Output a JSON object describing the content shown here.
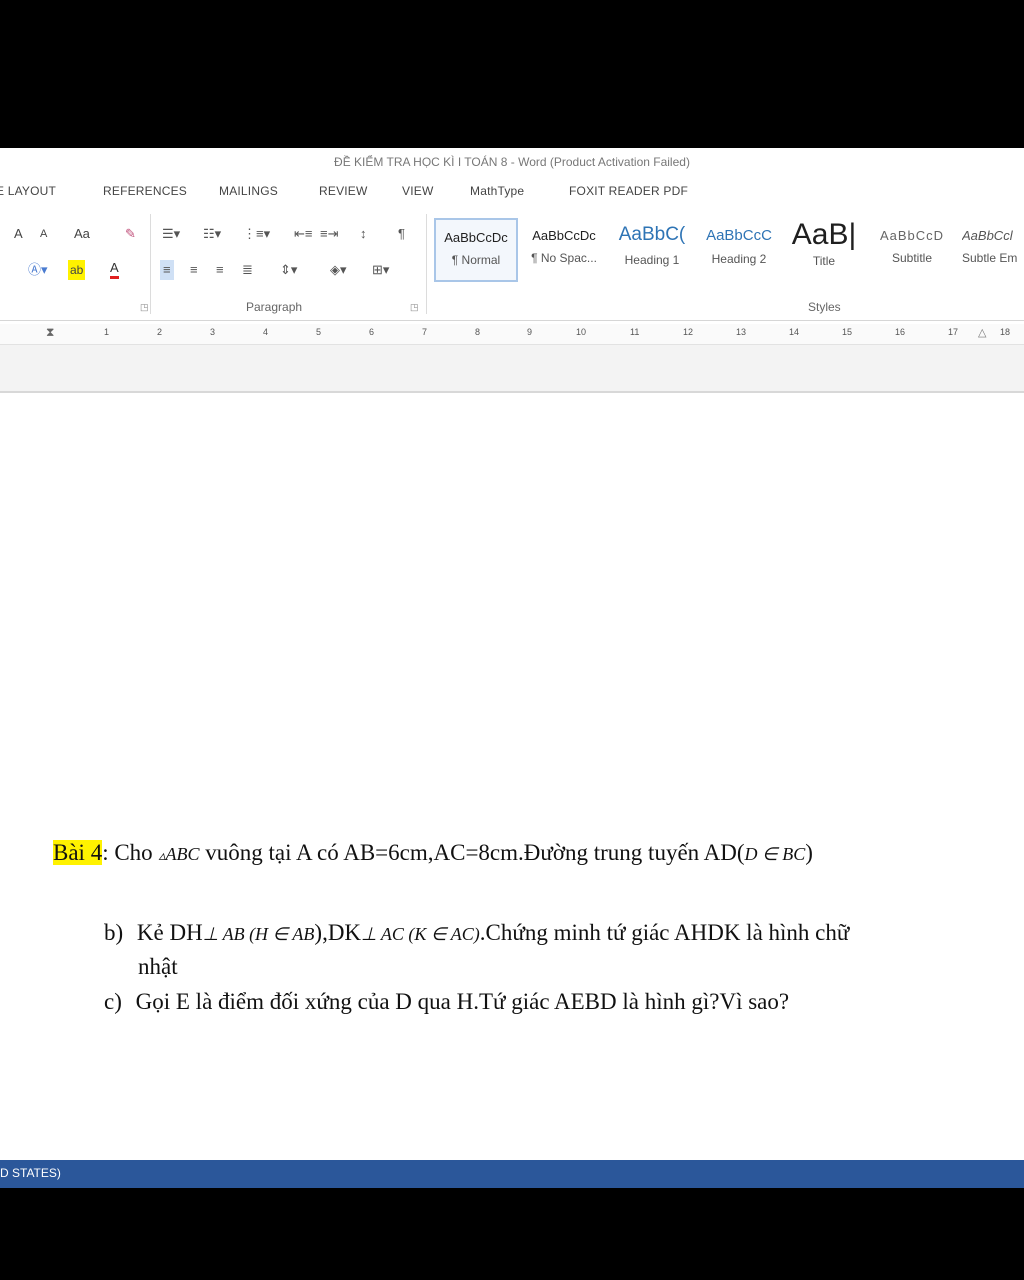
{
  "title": "ĐỀ KIỂM TRA HỌC KÌ I TOÁN 8 - Word (Product Activation Failed)",
  "tabs": [
    "E LAYOUT",
    "REFERENCES",
    "MAILINGS",
    "REVIEW",
    "VIEW",
    "MathType",
    "FOXIT READER PDF"
  ],
  "ribbon": {
    "font_group": {
      "grow_font": "A",
      "shrink_font": "A",
      "change_case": "Aa",
      "highlight": "ab",
      "font_color": "A"
    },
    "paragraph_label": "Paragraph",
    "styles_label": "Styles",
    "styles": [
      {
        "preview": "AaBbCcDc",
        "name": "¶ Normal"
      },
      {
        "preview": "AaBbCcDc",
        "name": "¶ No Spac..."
      },
      {
        "preview": "AaBbC(",
        "name": "Heading 1"
      },
      {
        "preview": "AaBbCcC",
        "name": "Heading 2"
      },
      {
        "preview": "AaB|",
        "name": "Title"
      },
      {
        "preview": "AaBbCcD",
        "name": "Subtitle"
      },
      {
        "preview": "AaBbCcl",
        "name": "Subtle Em"
      }
    ]
  },
  "ruler_numbers": [
    "1",
    "2",
    "3",
    "4",
    "5",
    "6",
    "7",
    "8",
    "9",
    "10",
    "11",
    "12",
    "13",
    "14",
    "15",
    "16",
    "17",
    "18"
  ],
  "document": {
    "problem_label": "Bài 4",
    "line1_a": ": Cho ",
    "line1_tri": "ABC",
    "line1_b": " vuông tại A có AB=6cm,AC=8cm.Đường trung tuyến AD(",
    "line1_math": "D ∈ BC",
    "line1_c": ")",
    "item_b_marker": "b)",
    "item_b_text1": "Kẻ DH",
    "item_b_math1": "⊥ AB (H ∈ AB",
    "item_b_text2": "),DK",
    "item_b_math2": "⊥ AC (K ∈ AC)",
    "item_b_text3": ".Chứng minh tứ giác AHDK là hình chữ",
    "item_b_cont": "nhật",
    "item_c_marker": "c)",
    "item_c_text": "Gọi E là điểm đối xứng của D qua H.Tứ giác AEBD là hình gì?Vì sao?"
  },
  "status": "D STATES)",
  "colors": {
    "statusbar": "#2b579a",
    "highlight": "#fff200"
  }
}
